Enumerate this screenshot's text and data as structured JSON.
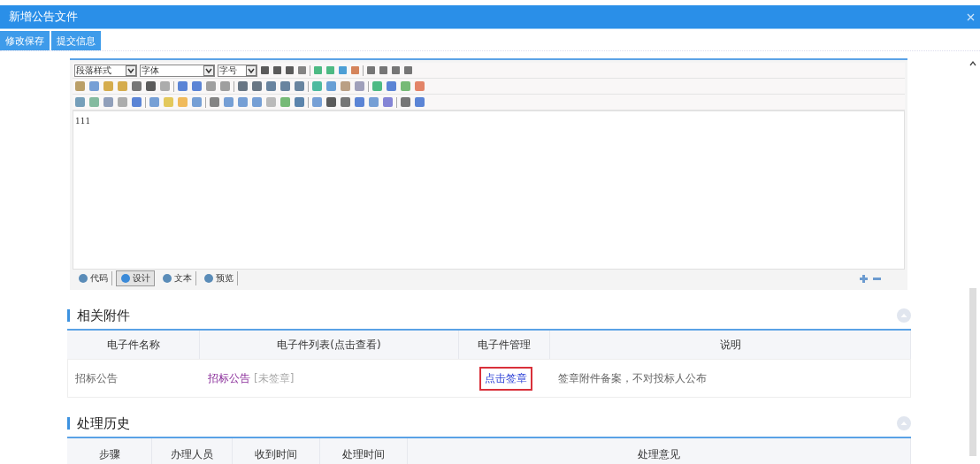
{
  "window": {
    "title": "新增公告文件"
  },
  "toolbar": {
    "buttons": [
      "修改保存",
      "提交信息"
    ]
  },
  "editor": {
    "selects": [
      {
        "value": "段落样式"
      },
      {
        "value": "字体"
      },
      {
        "value": "字号"
      }
    ],
    "content": "111",
    "modes": [
      {
        "label": "代码",
        "selected": false
      },
      {
        "label": "设计",
        "selected": true
      },
      {
        "label": "文本",
        "selected": false
      },
      {
        "label": "预览",
        "selected": false
      }
    ]
  },
  "attachments": {
    "title": "相关附件",
    "columns": [
      "电子件名称",
      "电子件列表(点击查看)",
      "电子件管理",
      "说明"
    ],
    "rows": [
      {
        "name": "招标公告",
        "file": "招标公告",
        "file_status": "[未签章]",
        "action": "点击签章",
        "note": "签章附件备案，不对投标人公布"
      }
    ]
  },
  "history": {
    "title": "处理历史",
    "columns": [
      "步骤",
      "办理人员",
      "收到时间",
      "处理时间",
      "处理意见"
    ]
  }
}
